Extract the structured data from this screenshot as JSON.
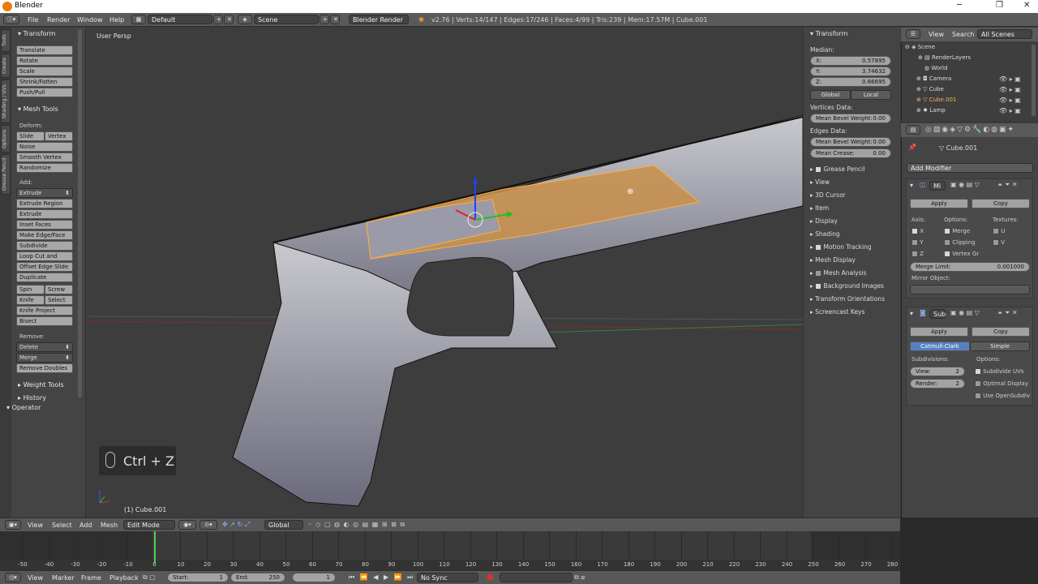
{
  "window": {
    "title": "Blender"
  },
  "info_header": {
    "menus": [
      "File",
      "Render",
      "Window",
      "Help"
    ],
    "screen_layout": "Default",
    "scene": "Scene",
    "render_engine": "Blender Render",
    "stats": "v2.76 | Verts:14/147 | Edges:17/246 | Faces:4/99 | Tris:239 | Mem:17.57M | Cube.001"
  },
  "tool_tabs": [
    "Tools",
    "Create",
    "Shading / UVs",
    "Options",
    "Grease Pencil"
  ],
  "tool_shelf": {
    "transform_header": "Transform",
    "transform_buttons": [
      "Translate",
      "Rotate",
      "Scale",
      "Shrink/Fatten",
      "Push/Pull"
    ],
    "mesh_tools_header": "Mesh Tools",
    "deform_label": "Deform:",
    "slide_edge": "Slide Ed",
    "vertex": "Vertex",
    "noise": "Noise",
    "smooth_vertex": "Smooth Vertex",
    "randomize": "Randomize",
    "add_label": "Add:",
    "extrude": "Extrude",
    "add_buttons": [
      "Extrude Region",
      "Extrude Individual",
      "Inset Faces",
      "Make Edge/Face",
      "Subdivide",
      "Loop Cut and Slide",
      "Offset Edge Slide",
      "Duplicate"
    ],
    "spin": "Spin",
    "screw": "Screw",
    "knife": "Knife",
    "select": "Select",
    "knife_project": "Knife Project",
    "bisect": "Bisect",
    "remove_label": "Remove:",
    "delete": "Delete",
    "merge": "Merge",
    "remove_doubles": "Remove Doubles",
    "weight_tools": "Weight Tools",
    "history": "History",
    "operator": "Operator"
  },
  "viewport": {
    "view_name": "User Persp",
    "object_label": "(1) Cube.001",
    "shortcut": "Ctrl + Z"
  },
  "n_panel": {
    "transform_header": "Transform",
    "median_label": "Median:",
    "x_label": "X:",
    "x": "0.57895",
    "y_label": "Y:",
    "y": "3.74632",
    "z_label": "Z:",
    "z": "0.66695",
    "global": "Global",
    "local": "Local",
    "vertices_data": "Vertices Data:",
    "mean_bevel_weight": "Mean Bevel Weight:",
    "mean_bevel_weight_v": "0.00",
    "edges_data": "Edges Data:",
    "mean_bevel_weight_e": "0.00",
    "mean_crease": "Mean Crease:",
    "mean_crease_v": "0.00",
    "sections": [
      "Grease Pencil",
      "View",
      "3D Cursor",
      "Item",
      "Display",
      "Shading",
      "Motion Tracking",
      "Mesh Display",
      "Mesh Analysis",
      "Background Images",
      "Transform Orientations",
      "Screencast Keys"
    ]
  },
  "outliner": {
    "menus": [
      "View",
      "Search",
      "All Scenes"
    ],
    "items": [
      "Scene",
      "RenderLayers",
      "World",
      "Camera",
      "Cube",
      "Cube.001",
      "Lamp"
    ]
  },
  "properties": {
    "object_name": "Cube.001",
    "add_modifier": "Add Modifier",
    "mirror": {
      "name": "Mi",
      "apply": "Apply",
      "copy": "Copy",
      "axis_label": "Axis:",
      "options_label": "Options:",
      "textures_label": "Textures:",
      "axes": [
        "X",
        "Y",
        "Z"
      ],
      "options": [
        "Merge",
        "Clipping",
        "Vertex Gr"
      ],
      "textures": [
        "U",
        "V"
      ],
      "merge_limit_label": "Merge Limit:",
      "merge_limit": "0.001000",
      "mirror_object_label": "Mirror Object:"
    },
    "subsurf": {
      "name": "Sub",
      "apply": "Apply",
      "copy": "Copy",
      "catmull": "Catmull-Clark",
      "simple": "Simple",
      "subdivisions_label": "Subdivisions:",
      "options_label": "Options:",
      "view_label": "View:",
      "view": "2",
      "render_label": "Render:",
      "render": "2",
      "options": [
        "Subdivide UVs",
        "Optimal Display",
        "Use OpenSubdiv"
      ]
    }
  },
  "timeline_header": {
    "menus": [
      "View",
      "Select",
      "Add",
      "Mesh"
    ],
    "mode": "Edit Mode",
    "orientation": "Global"
  },
  "timeline": {
    "ticks": [
      "-50",
      "-40",
      "-30",
      "-20",
      "-10",
      "0",
      "10",
      "20",
      "30",
      "40",
      "50",
      "60",
      "70",
      "80",
      "90",
      "100",
      "110",
      "120",
      "130",
      "140",
      "150",
      "160",
      "170",
      "180",
      "190",
      "200",
      "210",
      "220",
      "230",
      "240",
      "250",
      "260",
      "270",
      "280"
    ],
    "current_frame": 0
  },
  "timeline_footer": {
    "menus": [
      "View",
      "Marker",
      "Frame",
      "Playback"
    ],
    "start_label": "Start:",
    "start": "1",
    "end_label": "End:",
    "end": "250",
    "frame": "1",
    "sync": "No Sync"
  }
}
